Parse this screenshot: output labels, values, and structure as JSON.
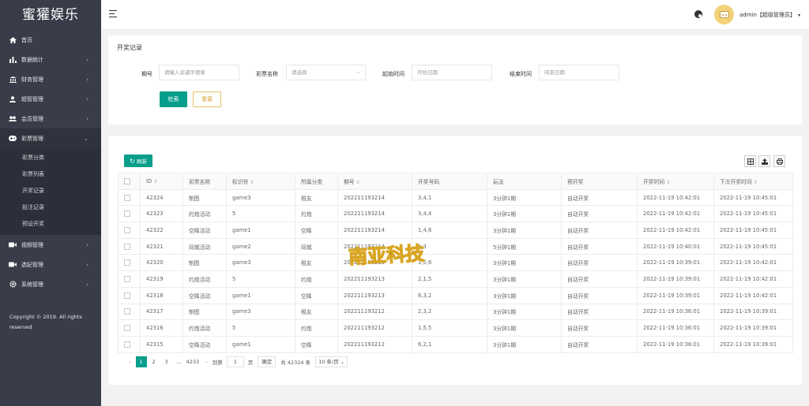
{
  "sidebar": {
    "logo": "蜜獾娱乐",
    "items": [
      {
        "label": "首页",
        "icon": "home-icon"
      },
      {
        "label": "数据统计",
        "icon": "bar-chart-icon"
      },
      {
        "label": "财务管理",
        "icon": "bank-icon"
      },
      {
        "label": "超管管理",
        "icon": "user-icon"
      },
      {
        "label": "会员管理",
        "icon": "users-icon"
      },
      {
        "label": "彩票管理",
        "icon": "gamepad-icon"
      }
    ],
    "submenu": [
      "彩票分类",
      "彩票列表",
      "开奖记录",
      "投注记录",
      "预设开奖"
    ],
    "items2": [
      {
        "label": "视频管理",
        "icon": "video-icon"
      },
      {
        "label": "选妃管理",
        "icon": "video-icon"
      },
      {
        "label": "系统管理",
        "icon": "gear-icon"
      }
    ],
    "copyright": "Copyright © 2019. All rights reserved"
  },
  "header": {
    "user": "admin【超级管理员】"
  },
  "search": {
    "title": "开奖记录",
    "issue_label": "期号",
    "issue_placeholder": "请输入关键字搜索",
    "lottery_label": "彩票名称",
    "lottery_placeholder": "请选择",
    "start_label": "起始时间",
    "start_placeholder": "开始日期",
    "end_label": "结束时间",
    "end_placeholder": "结束日期",
    "search_btn": "检索",
    "reset_btn": "重置"
  },
  "table": {
    "refresh_btn": "刷新",
    "headers": [
      "ID",
      "彩票名称",
      "标识符",
      "所属分类",
      "期号",
      "开奖号码",
      "玩法",
      "预开奖",
      "开奖时间",
      "下次开奖时间"
    ],
    "rows": [
      [
        "42324",
        "制图",
        "game3",
        "租友",
        "202211193214",
        "3,4,1",
        "3分钟1期",
        "自动开奖",
        "2022-11-19 10:42:01",
        "2022-11-19 10:45:01"
      ],
      [
        "42323",
        "约炮活动",
        "5",
        "约炮",
        "202211193214",
        "3,4,4",
        "3分钟1期",
        "自动开奖",
        "2022-11-19 10:42:01",
        "2022-11-19 10:45:01"
      ],
      [
        "42322",
        "空降活动",
        "game1",
        "空降",
        "202211193214",
        "1,4,6",
        "3分钟1期",
        "自动开奖",
        "2022-11-19 10:42:01",
        "2022-11-19 10:45:01"
      ],
      [
        "42321",
        "同城活动",
        "game2",
        "同城",
        "202211193214",
        "4,3",
        "5分钟1期",
        "自动开奖",
        "2022-11-19 10:40:01",
        "2022-11-19 10:45:01"
      ],
      [
        "42320",
        "制图",
        "game3",
        "租友",
        "202211193213",
        "1,5,6",
        "3分钟1期",
        "自动开奖",
        "2022-11-19 10:39:01",
        "2022-11-19 10:42:01"
      ],
      [
        "42319",
        "约炮活动",
        "5",
        "约炮",
        "202211193213",
        "2,1,5",
        "3分钟1期",
        "自动开奖",
        "2022-11-19 10:39:01",
        "2022-11-19 10:42:01"
      ],
      [
        "42318",
        "空降活动",
        "game1",
        "空降",
        "202211193213",
        "6,3,2",
        "3分钟1期",
        "自动开奖",
        "2022-11-19 10:39:01",
        "2022-11-19 10:42:01"
      ],
      [
        "42317",
        "制图",
        "game3",
        "租友",
        "202211193212",
        "2,3,2",
        "3分钟1期",
        "自动开奖",
        "2022-11-19 10:36:01",
        "2022-11-19 10:39:01"
      ],
      [
        "42316",
        "约炮活动",
        "5",
        "约炮",
        "202211193212",
        "1,5,5",
        "3分钟1期",
        "自动开奖",
        "2022-11-19 10:36:01",
        "2022-11-19 10:39:01"
      ],
      [
        "42315",
        "空降活动",
        "game1",
        "空降",
        "202211193212",
        "6,2,1",
        "3分钟1期",
        "自动开奖",
        "2022-11-19 10:36:01",
        "2022-11-19 10:39:01"
      ]
    ]
  },
  "pager": {
    "pages": [
      "1",
      "2",
      "3"
    ],
    "ellipsis": "...",
    "last": "4233",
    "goto_label": "到第",
    "goto_value": "1",
    "page_unit": "页",
    "go_btn": "确定",
    "total": "共 42324 条",
    "size": "10 条/页"
  },
  "watermark_text": "南亚科技"
}
